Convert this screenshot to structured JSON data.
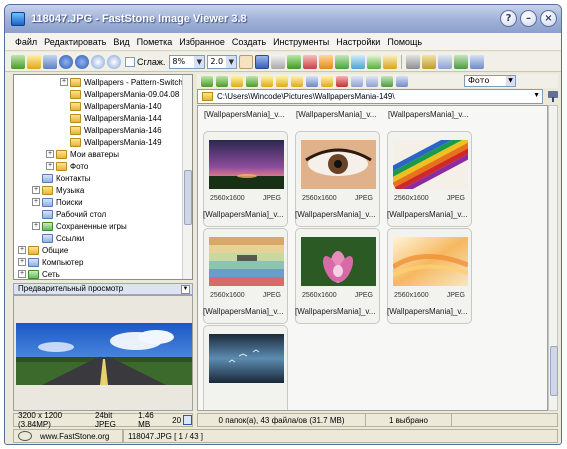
{
  "window": {
    "title": "118047.JPG - FastStone Image Viewer 3.8",
    "controls": [
      "?",
      "–",
      "×"
    ]
  },
  "menu": [
    "Файл",
    "Редактировать",
    "Вид",
    "Пометка",
    "Избранное",
    "Создать",
    "Инструменты",
    "Настройки",
    "Помощь"
  ],
  "toolbar": {
    "smooth_label": "Сглаж.",
    "zoom_value": "8%",
    "ratio_value": "2.0"
  },
  "tree": [
    {
      "label": "Wallpapers - Pattern-Switch",
      "indent": 3,
      "exp": "+",
      "icon": "folder"
    },
    {
      "label": "WallpapersMania-09.04.08",
      "indent": 3,
      "exp": "",
      "icon": "folder"
    },
    {
      "label": "WallpapersMania-140",
      "indent": 3,
      "exp": "",
      "icon": "folder"
    },
    {
      "label": "WallpapersMania-144",
      "indent": 3,
      "exp": "",
      "icon": "folder"
    },
    {
      "label": "WallpapersMania-146",
      "indent": 3,
      "exp": "",
      "icon": "folder"
    },
    {
      "label": "WallpapersMania-149",
      "indent": 3,
      "exp": "",
      "icon": "folder"
    },
    {
      "label": "Мои аватеры",
      "indent": 2,
      "exp": "+",
      "icon": "folder"
    },
    {
      "label": "Фото",
      "indent": 2,
      "exp": "+",
      "icon": "folder"
    },
    {
      "label": "Контакты",
      "indent": 1,
      "exp": "",
      "icon": "blue"
    },
    {
      "label": "Музыка",
      "indent": 1,
      "exp": "+",
      "icon": "folder"
    },
    {
      "label": "Поиски",
      "indent": 1,
      "exp": "+",
      "icon": "blue"
    },
    {
      "label": "Рабочий стол",
      "indent": 1,
      "exp": "",
      "icon": "blue"
    },
    {
      "label": "Сохраненные игры",
      "indent": 1,
      "exp": "+",
      "icon": "green"
    },
    {
      "label": "Ссылки",
      "indent": 1,
      "exp": "",
      "icon": "blue"
    },
    {
      "label": "Общие",
      "indent": 0,
      "exp": "+",
      "icon": "folder"
    },
    {
      "label": "Компьютер",
      "indent": 0,
      "exp": "+",
      "icon": "blue"
    },
    {
      "label": "Сеть",
      "indent": 0,
      "exp": "+",
      "icon": "green"
    }
  ],
  "preview": {
    "title": "Предварительный просмотр"
  },
  "address": {
    "path": "C:\\Users\\Wincode\\Pictures\\WallpapersMania-149\\",
    "sort_value": "Фото"
  },
  "grid": {
    "top_captions": [
      "[WallpapersMania]_v...",
      "[WallpapersMania]_v...",
      "[WallpapersMania]_v..."
    ],
    "thumbs": [
      {
        "caption": "[WallpapersMania]_v...",
        "dims": "2560x1600",
        "format": "JPEG",
        "selected": false
      },
      {
        "caption": "[WallpapersMania]_v...",
        "dims": "2560x1600",
        "format": "JPEG",
        "selected": false
      },
      {
        "caption": "[WallpapersMania]_v...",
        "dims": "2560x1600",
        "format": "JPEG",
        "selected": false
      },
      {
        "caption": "[WallpapersMania]_v...",
        "dims": "2560x1600",
        "format": "JPEG",
        "selected": false
      },
      {
        "caption": "[WallpapersMania]_v...",
        "dims": "2560x1600",
        "format": "JPEG",
        "selected": false
      },
      {
        "caption": "[WallpapersMania]_v...",
        "dims": "2560x1600",
        "format": "JPEG",
        "selected": false
      },
      {
        "caption": "",
        "dims": "",
        "format": "",
        "selected": false
      }
    ]
  },
  "status": {
    "image_info": "3200 x 1200 (3.84MP)",
    "bit_depth": "24bit JPEG",
    "file_size": "1.46 MB",
    "zoom": "20",
    "folder_info": "0 папок(а), 43 файла/ов (31.7 MB)",
    "selected": "1 выбрано",
    "website": "www.FastStone.org",
    "file_pos": "118047.JPG [ 1 / 43 ]"
  }
}
